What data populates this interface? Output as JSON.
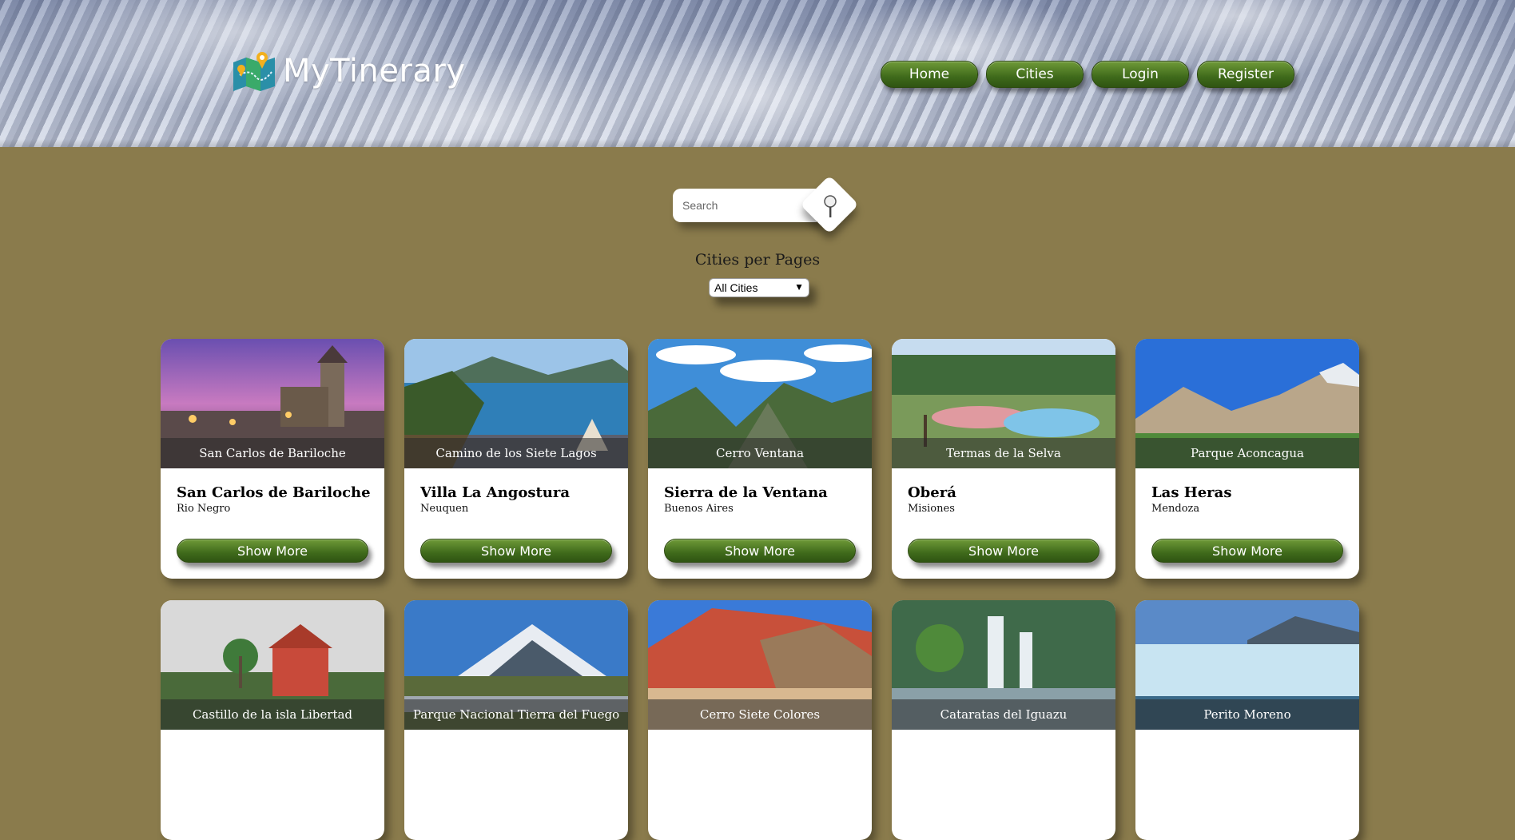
{
  "brand": {
    "name": "MyTinerary",
    "logo_icon": "map-pin-icon"
  },
  "nav": {
    "items": [
      "Home",
      "Cities",
      "Login",
      "Register"
    ]
  },
  "search": {
    "placeholder": "Search",
    "button_icon": "magnifier-icon"
  },
  "per_page": {
    "label": "Cities per Pages",
    "selected": "All Cities"
  },
  "cards": [
    {
      "caption": "San Carlos de Bariloche",
      "name": "San Carlos de Bariloche",
      "province": "Rio Negro",
      "button": "Show More"
    },
    {
      "caption": "Camino de los Siete Lagos",
      "name": "Villa La Angostura",
      "province": "Neuquen",
      "button": "Show More"
    },
    {
      "caption": "Cerro Ventana",
      "name": "Sierra de la Ventana",
      "province": "Buenos Aires",
      "button": "Show More"
    },
    {
      "caption": "Termas de la Selva",
      "name": "Oberá",
      "province": "Misiones",
      "button": "Show More"
    },
    {
      "caption": "Parque Aconcagua",
      "name": "Las Heras",
      "province": "Mendoza",
      "button": "Show More"
    },
    {
      "caption": "Castillo de la isla Libertad"
    },
    {
      "caption": "Parque Nacional Tierra del Fuego"
    },
    {
      "caption": "Cerro Siete Colores"
    },
    {
      "caption": "Cataratas del Iguazu"
    },
    {
      "caption": "Perito Moreno"
    }
  ],
  "colors": {
    "background": "#8a7b4c",
    "button_green": "#4f7a25",
    "card": "#ffffff"
  }
}
